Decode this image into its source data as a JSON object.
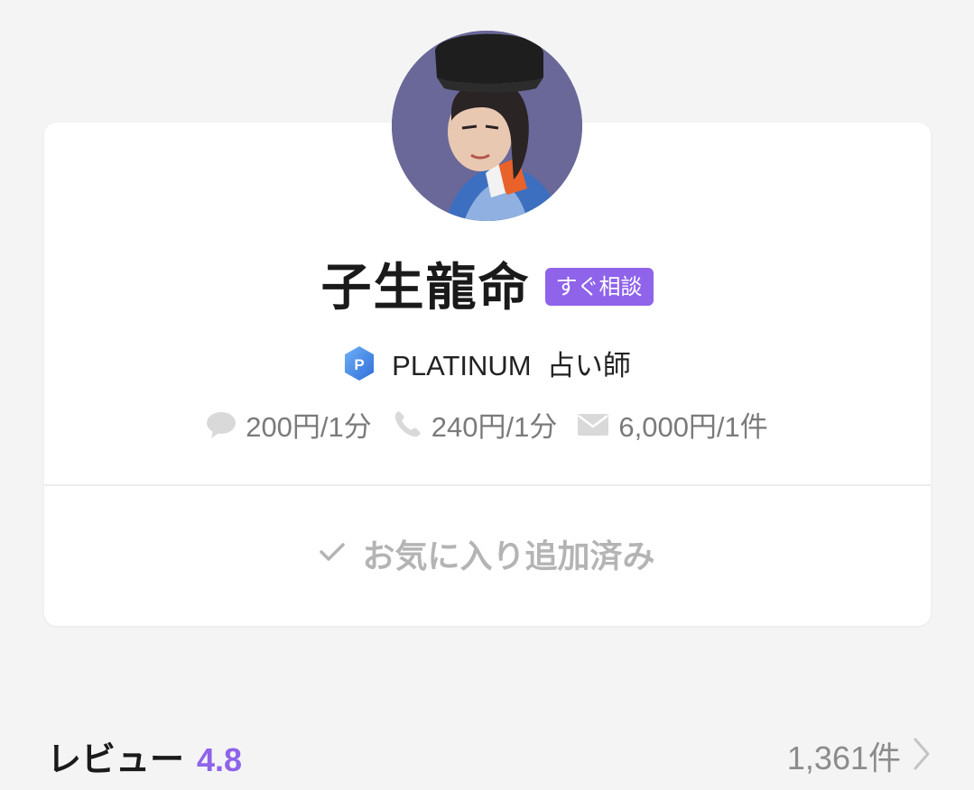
{
  "profile": {
    "name": "子生龍命",
    "badge": "すぐ相談",
    "rank": "PLATINUM",
    "role": "占い師",
    "rank_icon_letter": "P"
  },
  "prices": [
    {
      "icon": "chat-bubble-icon",
      "label": "200円/1分"
    },
    {
      "icon": "phone-icon",
      "label": "240円/1分"
    },
    {
      "icon": "mail-icon",
      "label": "6,000円/1件"
    }
  ],
  "favorite": {
    "icon": "check-icon",
    "label": "お気に入り追加済み"
  },
  "review": {
    "label": "レビュー",
    "score": "4.8",
    "count": "1,361件",
    "icon": "chevron-right-icon"
  },
  "colors": {
    "accent": "#8f63ea",
    "background": "#f4f4f5",
    "card": "#ffffff",
    "muted_text": "#7a7a7a",
    "rank_icon": "#4a8ae8"
  }
}
